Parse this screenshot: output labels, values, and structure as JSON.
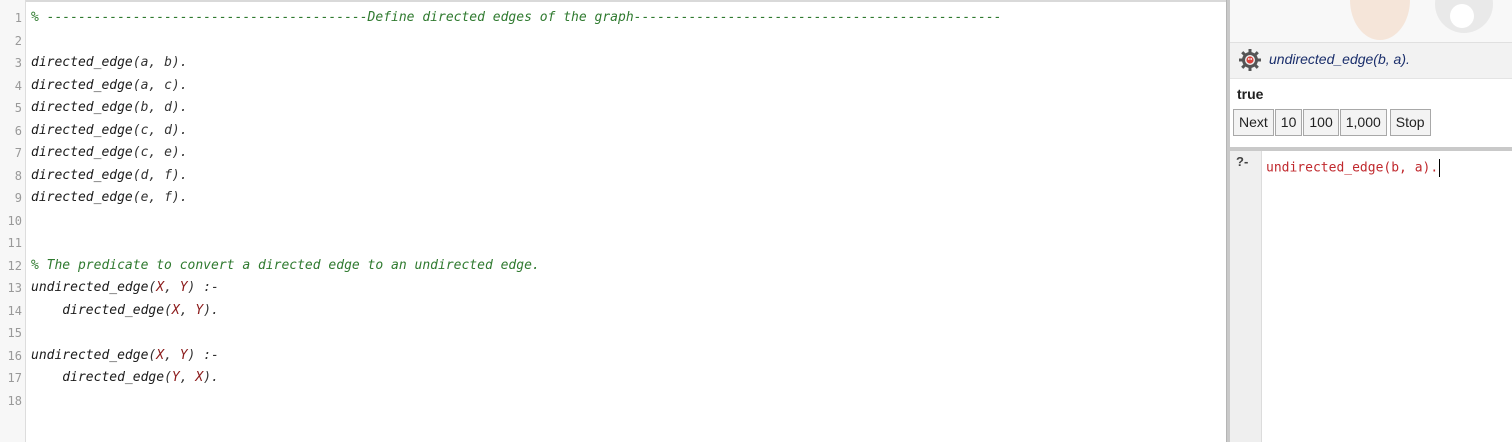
{
  "editor": {
    "lines": [
      {
        "n": "1",
        "tokens": [
          {
            "t": "% -----------------------------------------Define directed edges of the graph-----------------------------------------------",
            "c": "comment"
          }
        ]
      },
      {
        "n": "2",
        "tokens": []
      },
      {
        "n": "3",
        "tokens": [
          {
            "t": "directed_edge",
            "c": "pred"
          },
          {
            "t": "(",
            "c": "punct"
          },
          {
            "t": "a",
            "c": "atom"
          },
          {
            "t": ", ",
            "c": "punct"
          },
          {
            "t": "b",
            "c": "atom"
          },
          {
            "t": ").",
            "c": "punct"
          }
        ]
      },
      {
        "n": "4",
        "tokens": [
          {
            "t": "directed_edge",
            "c": "pred"
          },
          {
            "t": "(",
            "c": "punct"
          },
          {
            "t": "a",
            "c": "atom"
          },
          {
            "t": ", ",
            "c": "punct"
          },
          {
            "t": "c",
            "c": "atom"
          },
          {
            "t": ").",
            "c": "punct"
          }
        ]
      },
      {
        "n": "5",
        "tokens": [
          {
            "t": "directed_edge",
            "c": "pred"
          },
          {
            "t": "(",
            "c": "punct"
          },
          {
            "t": "b",
            "c": "atom"
          },
          {
            "t": ", ",
            "c": "punct"
          },
          {
            "t": "d",
            "c": "atom"
          },
          {
            "t": ").",
            "c": "punct"
          }
        ]
      },
      {
        "n": "6",
        "tokens": [
          {
            "t": "directed_edge",
            "c": "pred"
          },
          {
            "t": "(",
            "c": "punct"
          },
          {
            "t": "c",
            "c": "atom"
          },
          {
            "t": ", ",
            "c": "punct"
          },
          {
            "t": "d",
            "c": "atom"
          },
          {
            "t": ").",
            "c": "punct"
          }
        ]
      },
      {
        "n": "7",
        "tokens": [
          {
            "t": "directed_edge",
            "c": "pred"
          },
          {
            "t": "(",
            "c": "punct"
          },
          {
            "t": "c",
            "c": "atom"
          },
          {
            "t": ", ",
            "c": "punct"
          },
          {
            "t": "e",
            "c": "atom"
          },
          {
            "t": ").",
            "c": "punct"
          }
        ]
      },
      {
        "n": "8",
        "tokens": [
          {
            "t": "directed_edge",
            "c": "pred"
          },
          {
            "t": "(",
            "c": "punct"
          },
          {
            "t": "d",
            "c": "atom"
          },
          {
            "t": ", ",
            "c": "punct"
          },
          {
            "t": "f",
            "c": "atom"
          },
          {
            "t": ").",
            "c": "punct"
          }
        ]
      },
      {
        "n": "9",
        "tokens": [
          {
            "t": "directed_edge",
            "c": "pred"
          },
          {
            "t": "(",
            "c": "punct"
          },
          {
            "t": "e",
            "c": "atom"
          },
          {
            "t": ", ",
            "c": "punct"
          },
          {
            "t": "f",
            "c": "atom"
          },
          {
            "t": ").",
            "c": "punct"
          }
        ]
      },
      {
        "n": "10",
        "tokens": []
      },
      {
        "n": "11",
        "tokens": []
      },
      {
        "n": "12",
        "tokens": [
          {
            "t": "% The predicate to convert a directed edge to an undirected edge.",
            "c": "comment"
          }
        ]
      },
      {
        "n": "13",
        "tokens": [
          {
            "t": "undirected_edge",
            "c": "pred"
          },
          {
            "t": "(",
            "c": "punct"
          },
          {
            "t": "X",
            "c": "var"
          },
          {
            "t": ", ",
            "c": "punct"
          },
          {
            "t": "Y",
            "c": "var"
          },
          {
            "t": ") :-",
            "c": "punct"
          }
        ]
      },
      {
        "n": "14",
        "tokens": [
          {
            "t": "    directed_edge",
            "c": "pred"
          },
          {
            "t": "(",
            "c": "punct"
          },
          {
            "t": "X",
            "c": "var"
          },
          {
            "t": ", ",
            "c": "punct"
          },
          {
            "t": "Y",
            "c": "var"
          },
          {
            "t": ").",
            "c": "punct"
          }
        ]
      },
      {
        "n": "15",
        "tokens": []
      },
      {
        "n": "16",
        "tokens": [
          {
            "t": "undirected_edge",
            "c": "pred"
          },
          {
            "t": "(",
            "c": "punct"
          },
          {
            "t": "X",
            "c": "var"
          },
          {
            "t": ", ",
            "c": "punct"
          },
          {
            "t": "Y",
            "c": "var"
          },
          {
            "t": ") :-",
            "c": "punct"
          }
        ]
      },
      {
        "n": "17",
        "tokens": [
          {
            "t": "    directed_edge",
            "c": "pred"
          },
          {
            "t": "(",
            "c": "punct"
          },
          {
            "t": "Y",
            "c": "var"
          },
          {
            "t": ", ",
            "c": "punct"
          },
          {
            "t": "X",
            "c": "var"
          },
          {
            "t": ").",
            "c": "punct"
          }
        ]
      },
      {
        "n": "18",
        "tokens": []
      }
    ]
  },
  "answer": {
    "query": "undirected_edge(b, a).",
    "result": "true",
    "buttons": [
      "Next",
      "10",
      "100",
      "1,000"
    ],
    "stop_label": "Stop",
    "icon": "gear-logo-icon"
  },
  "query_panel": {
    "prompt": "?-",
    "input": "undirected_edge(b, a)."
  },
  "colors": {
    "comment": "#2f7a2f",
    "variable": "#8b1a1a",
    "query_text": "#c0282d",
    "answer_header": "#1a2e6b"
  }
}
